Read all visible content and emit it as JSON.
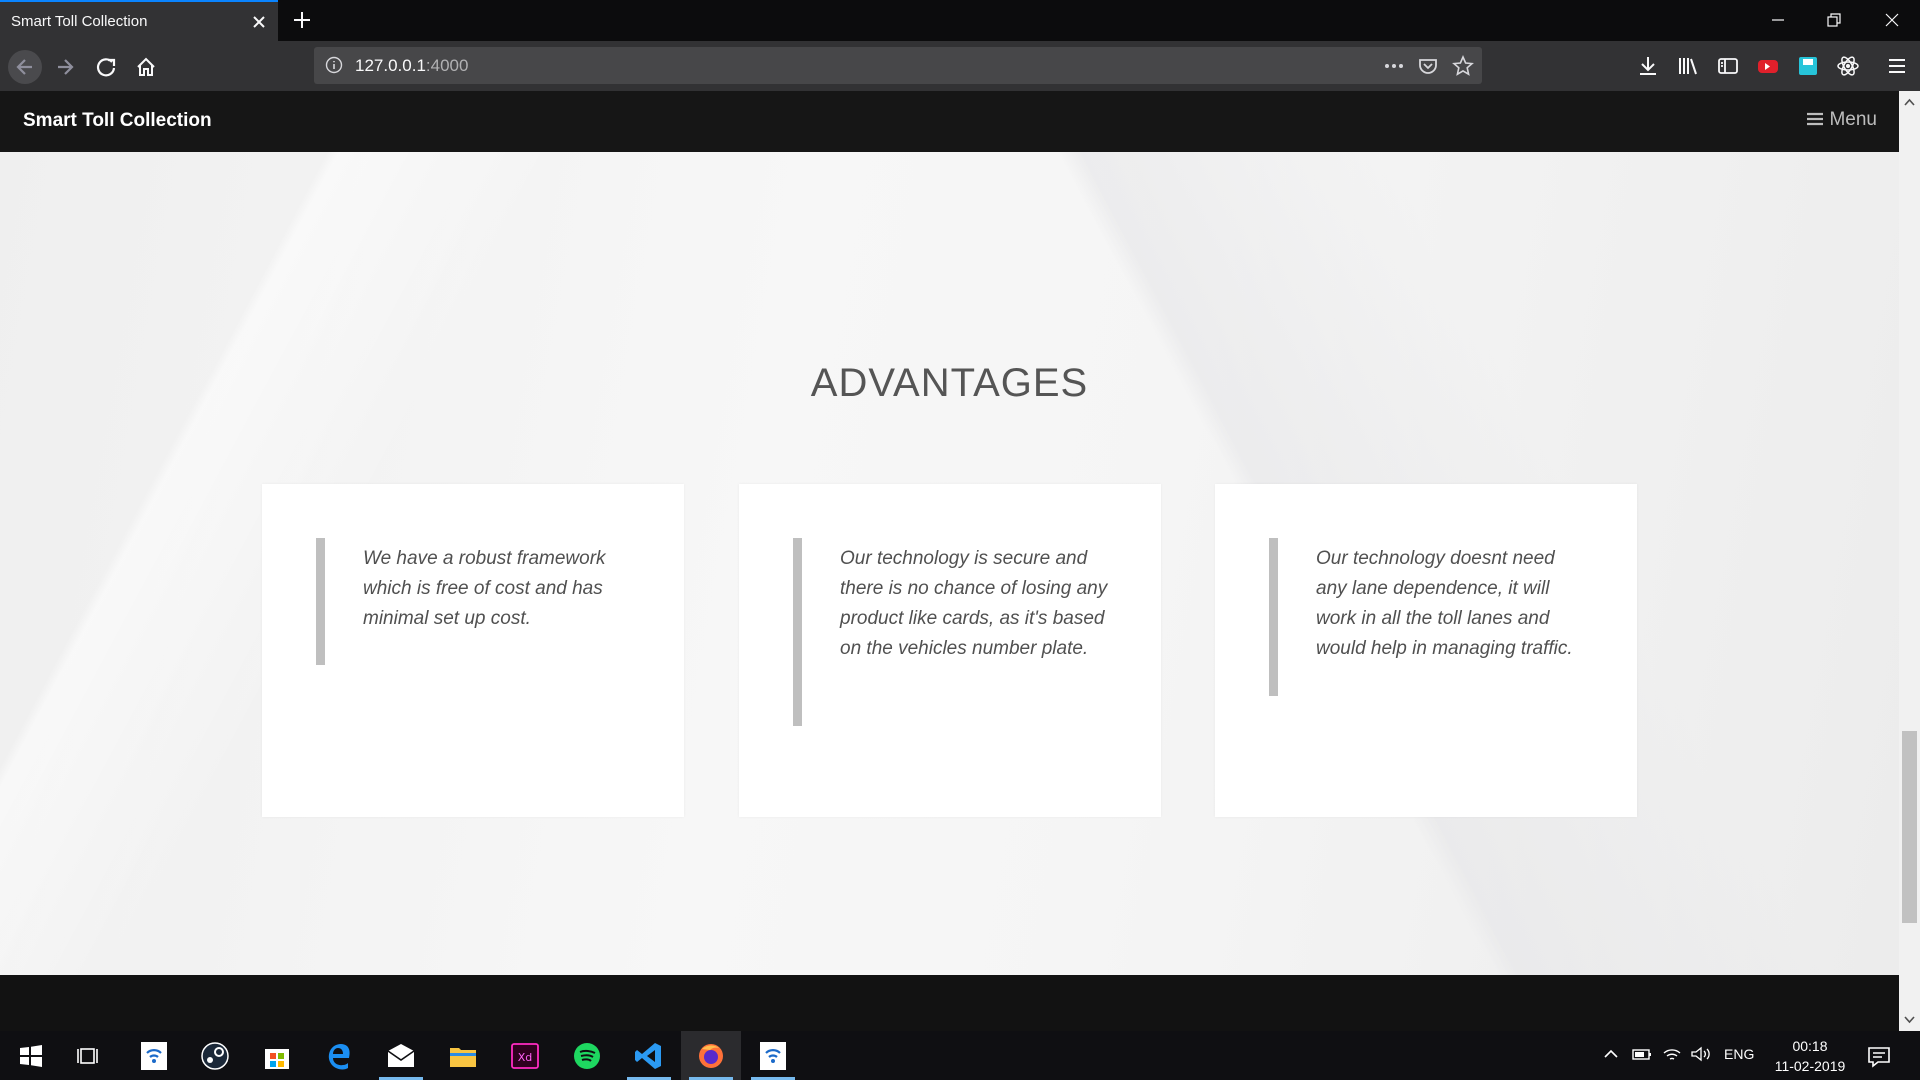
{
  "browser": {
    "tab_title": "Smart Toll Collection",
    "url_host": "127.0.0.1",
    "url_port": ":4000"
  },
  "site": {
    "brand": "Smart Toll Collection",
    "menu_label": "Menu",
    "section_title": "ADVANTAGES",
    "cards": [
      {
        "text": "We have a robust framework which is free of cost and has minimal set up cost."
      },
      {
        "text": "Our technology is secure and there is no chance of losing any product like cards, as it's based on the vehicles number plate."
      },
      {
        "text": "Our technology doesnt need any lane dependence, it will work in all the toll lanes and would help in managing traffic."
      }
    ]
  },
  "taskbar": {
    "language": "ENG",
    "time": "00:18",
    "date": "11-02-2019"
  },
  "colors": {
    "tab_accent": "#0a84ff",
    "page_background": "#f3f3f4",
    "navbar": "#161616",
    "card": "#ffffff"
  }
}
